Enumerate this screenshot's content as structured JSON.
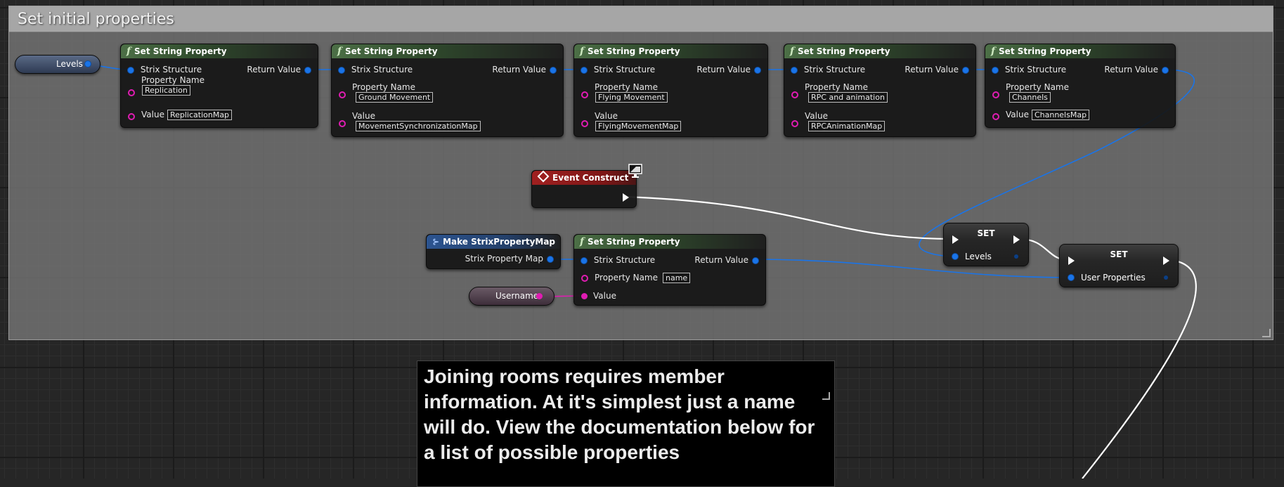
{
  "comment": {
    "title": "Set initial properties"
  },
  "variables": {
    "levels": "Levels",
    "username": "Username"
  },
  "set_string_nodes": [
    {
      "title": "Set String Property",
      "in_struct": "Strix Structure",
      "return": "Return Value",
      "prop_label": "Property Name",
      "prop_value": "Replication",
      "value_label": "Value",
      "value": "ReplicationMap"
    },
    {
      "title": "Set String Property",
      "in_struct": "Strix Structure",
      "return": "Return Value",
      "prop_label": "Property Name",
      "prop_value": "Ground Movement",
      "value_label": "Value",
      "value": "MovementSynchronizationMap"
    },
    {
      "title": "Set String Property",
      "in_struct": "Strix Structure",
      "return": "Return Value",
      "prop_label": "Property Name",
      "prop_value": "Flying Movement",
      "value_label": "Value",
      "value": "FlyingMovementMap"
    },
    {
      "title": "Set String Property",
      "in_struct": "Strix Structure",
      "return": "Return Value",
      "prop_label": "Property Name",
      "prop_value": "RPC and animation",
      "value_label": "Value",
      "value": "RPCAnimationMap"
    },
    {
      "title": "Set String Property",
      "in_struct": "Strix Structure",
      "return": "Return Value",
      "prop_label": "Property Name",
      "prop_value": "Channels",
      "value_label": "Value",
      "value": "ChannelsMap"
    }
  ],
  "event_node": {
    "title": "Event Construct"
  },
  "make_node": {
    "title": "Make StrixPropertyMap",
    "output": "Strix Property Map"
  },
  "name_node": {
    "title": "Set String Property",
    "in_struct": "Strix Structure",
    "return": "Return Value",
    "prop_label": "Property Name",
    "prop_value": "name",
    "value_label": "Value"
  },
  "set_levels": {
    "title": "SET",
    "pin": "Levels"
  },
  "set_user": {
    "title": "SET",
    "pin": "User Properties"
  },
  "note": {
    "text": "Joining rooms requires member information. At it's simplest just a name will do. View the documentation below for a list of possible properties"
  },
  "colors": {
    "struct_pin": "#1a74e8",
    "string_pin": "#e01cb2",
    "exec_wire": "#ffffff",
    "event_header": "#a02020",
    "function_header": "#4c6f46"
  }
}
